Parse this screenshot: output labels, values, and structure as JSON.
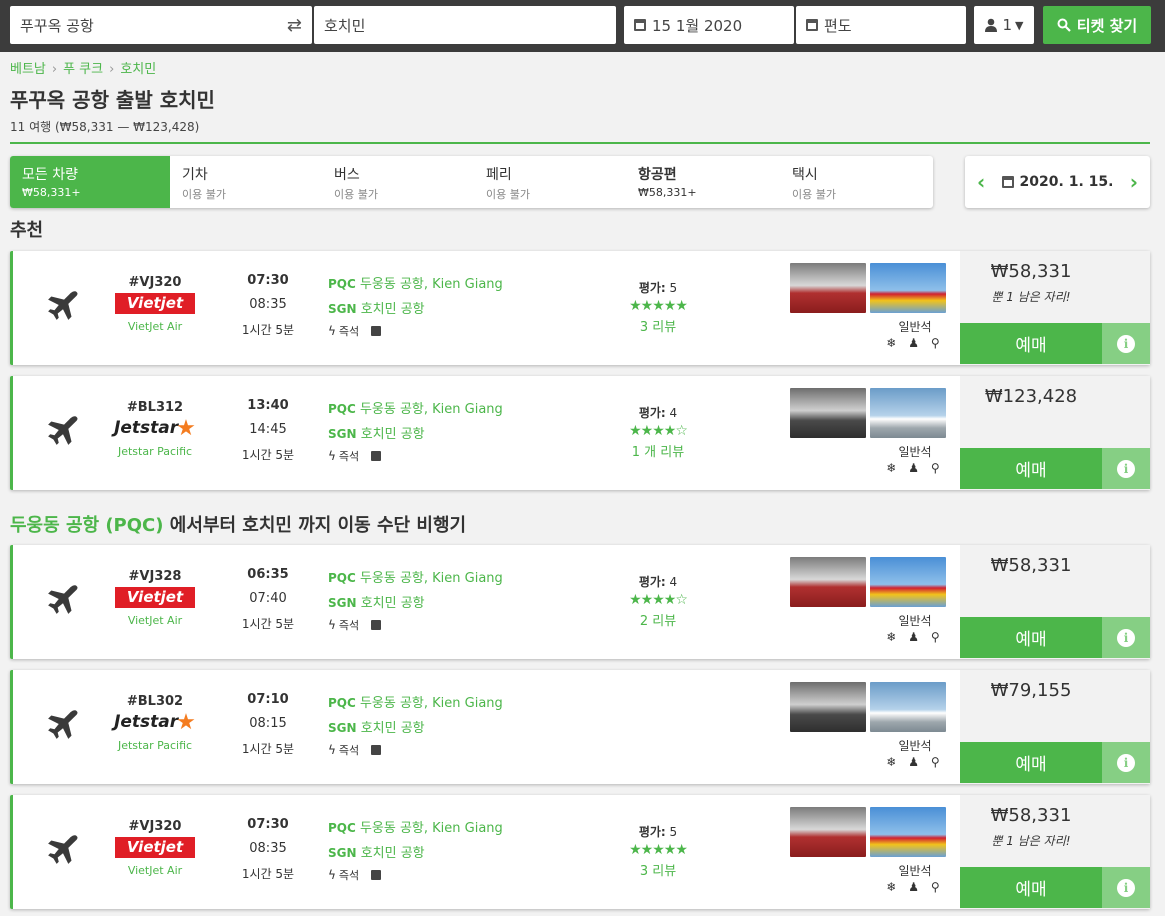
{
  "search": {
    "from": "푸꾸옥 공항",
    "to": "호치민",
    "date": "15 1월 2020",
    "return": "편도",
    "passengers": "1",
    "button": "티켓 찾기"
  },
  "breadcrumb": [
    "베트남",
    "푸 쿠크",
    "호치민"
  ],
  "page": {
    "title": "푸꾸옥 공항 출발 호치민",
    "subtitle": "11 여행 (₩58,331 — ₩123,428)"
  },
  "tabs": [
    {
      "label": "모든 차량",
      "sub": "₩58,331+"
    },
    {
      "label": "기차",
      "sub": "이용 불가"
    },
    {
      "label": "버스",
      "sub": "이용 불가"
    },
    {
      "label": "페리",
      "sub": "이용 불가"
    },
    {
      "label": "항공편",
      "sub": "₩58,331+"
    },
    {
      "label": "택시",
      "sub": "이용 불가"
    }
  ],
  "date_nav": {
    "date": "2020. 1. 15."
  },
  "sections": {
    "recommended": "추천",
    "from_place": "두웅동 공항 (PQC)",
    "route_rest": " 에서부터 호치민 까지 이동 수단 비행기"
  },
  "common": {
    "from_code": "PQC",
    "from_name": "두웅동 공항, Kien Giang",
    "to_code": "SGN",
    "to_name": "호치민 공항",
    "instant": "즉석",
    "rating_label": "평가:",
    "seat_class": "일반석",
    "book": "예매",
    "info": "i",
    "amenity_icons": "❄ ♟ ⚲"
  },
  "flights": [
    {
      "number": "#VJ320",
      "logo": "vietjet",
      "logo_text": "Vietjet Air",
      "carrier": "VietJet Air",
      "dep": "07:30",
      "arr": "08:35",
      "dur": "1시간 5분",
      "rating": "5",
      "stars": "★★★★★",
      "reviews": "3 리뷰",
      "price": "₩58,331",
      "seats_left": "뿐 1 남은 자리!"
    },
    {
      "number": "#BL312",
      "logo": "jetstar",
      "logo_text": "Jetstar",
      "carrier": "Jetstar Pacific",
      "dep": "13:40",
      "arr": "14:45",
      "dur": "1시간 5분",
      "rating": "4",
      "stars": "★★★★☆",
      "reviews": "1 개 리뷰",
      "price": "₩123,428",
      "seats_left": ""
    },
    {
      "number": "#VJ328",
      "logo": "vietjet",
      "logo_text": "Vietjet Air",
      "carrier": "VietJet Air",
      "dep": "06:35",
      "arr": "07:40",
      "dur": "1시간 5분",
      "rating": "4",
      "stars": "★★★★☆",
      "reviews": "2 리뷰",
      "price": "₩58,331",
      "seats_left": ""
    },
    {
      "number": "#BL302",
      "logo": "jetstar",
      "logo_text": "Jetstar",
      "carrier": "Jetstar Pacific",
      "dep": "07:10",
      "arr": "08:15",
      "dur": "1시간 5분",
      "rating": "",
      "stars": "",
      "reviews": "",
      "price": "₩79,155",
      "seats_left": ""
    },
    {
      "number": "#VJ320",
      "logo": "vietjet",
      "logo_text": "Vietjet Air",
      "carrier": "VietJet Air",
      "dep": "07:30",
      "arr": "08:35",
      "dur": "1시간 5분",
      "rating": "5",
      "stars": "★★★★★",
      "reviews": "3 리뷰",
      "price": "₩58,331",
      "seats_left": "뿐 1 남은 자리!"
    }
  ],
  "colors": {
    "accent": "#4cb64a",
    "topbar": "#3c3c3c",
    "vietjet": "#e01e26",
    "jetstar": "#f47c20"
  }
}
